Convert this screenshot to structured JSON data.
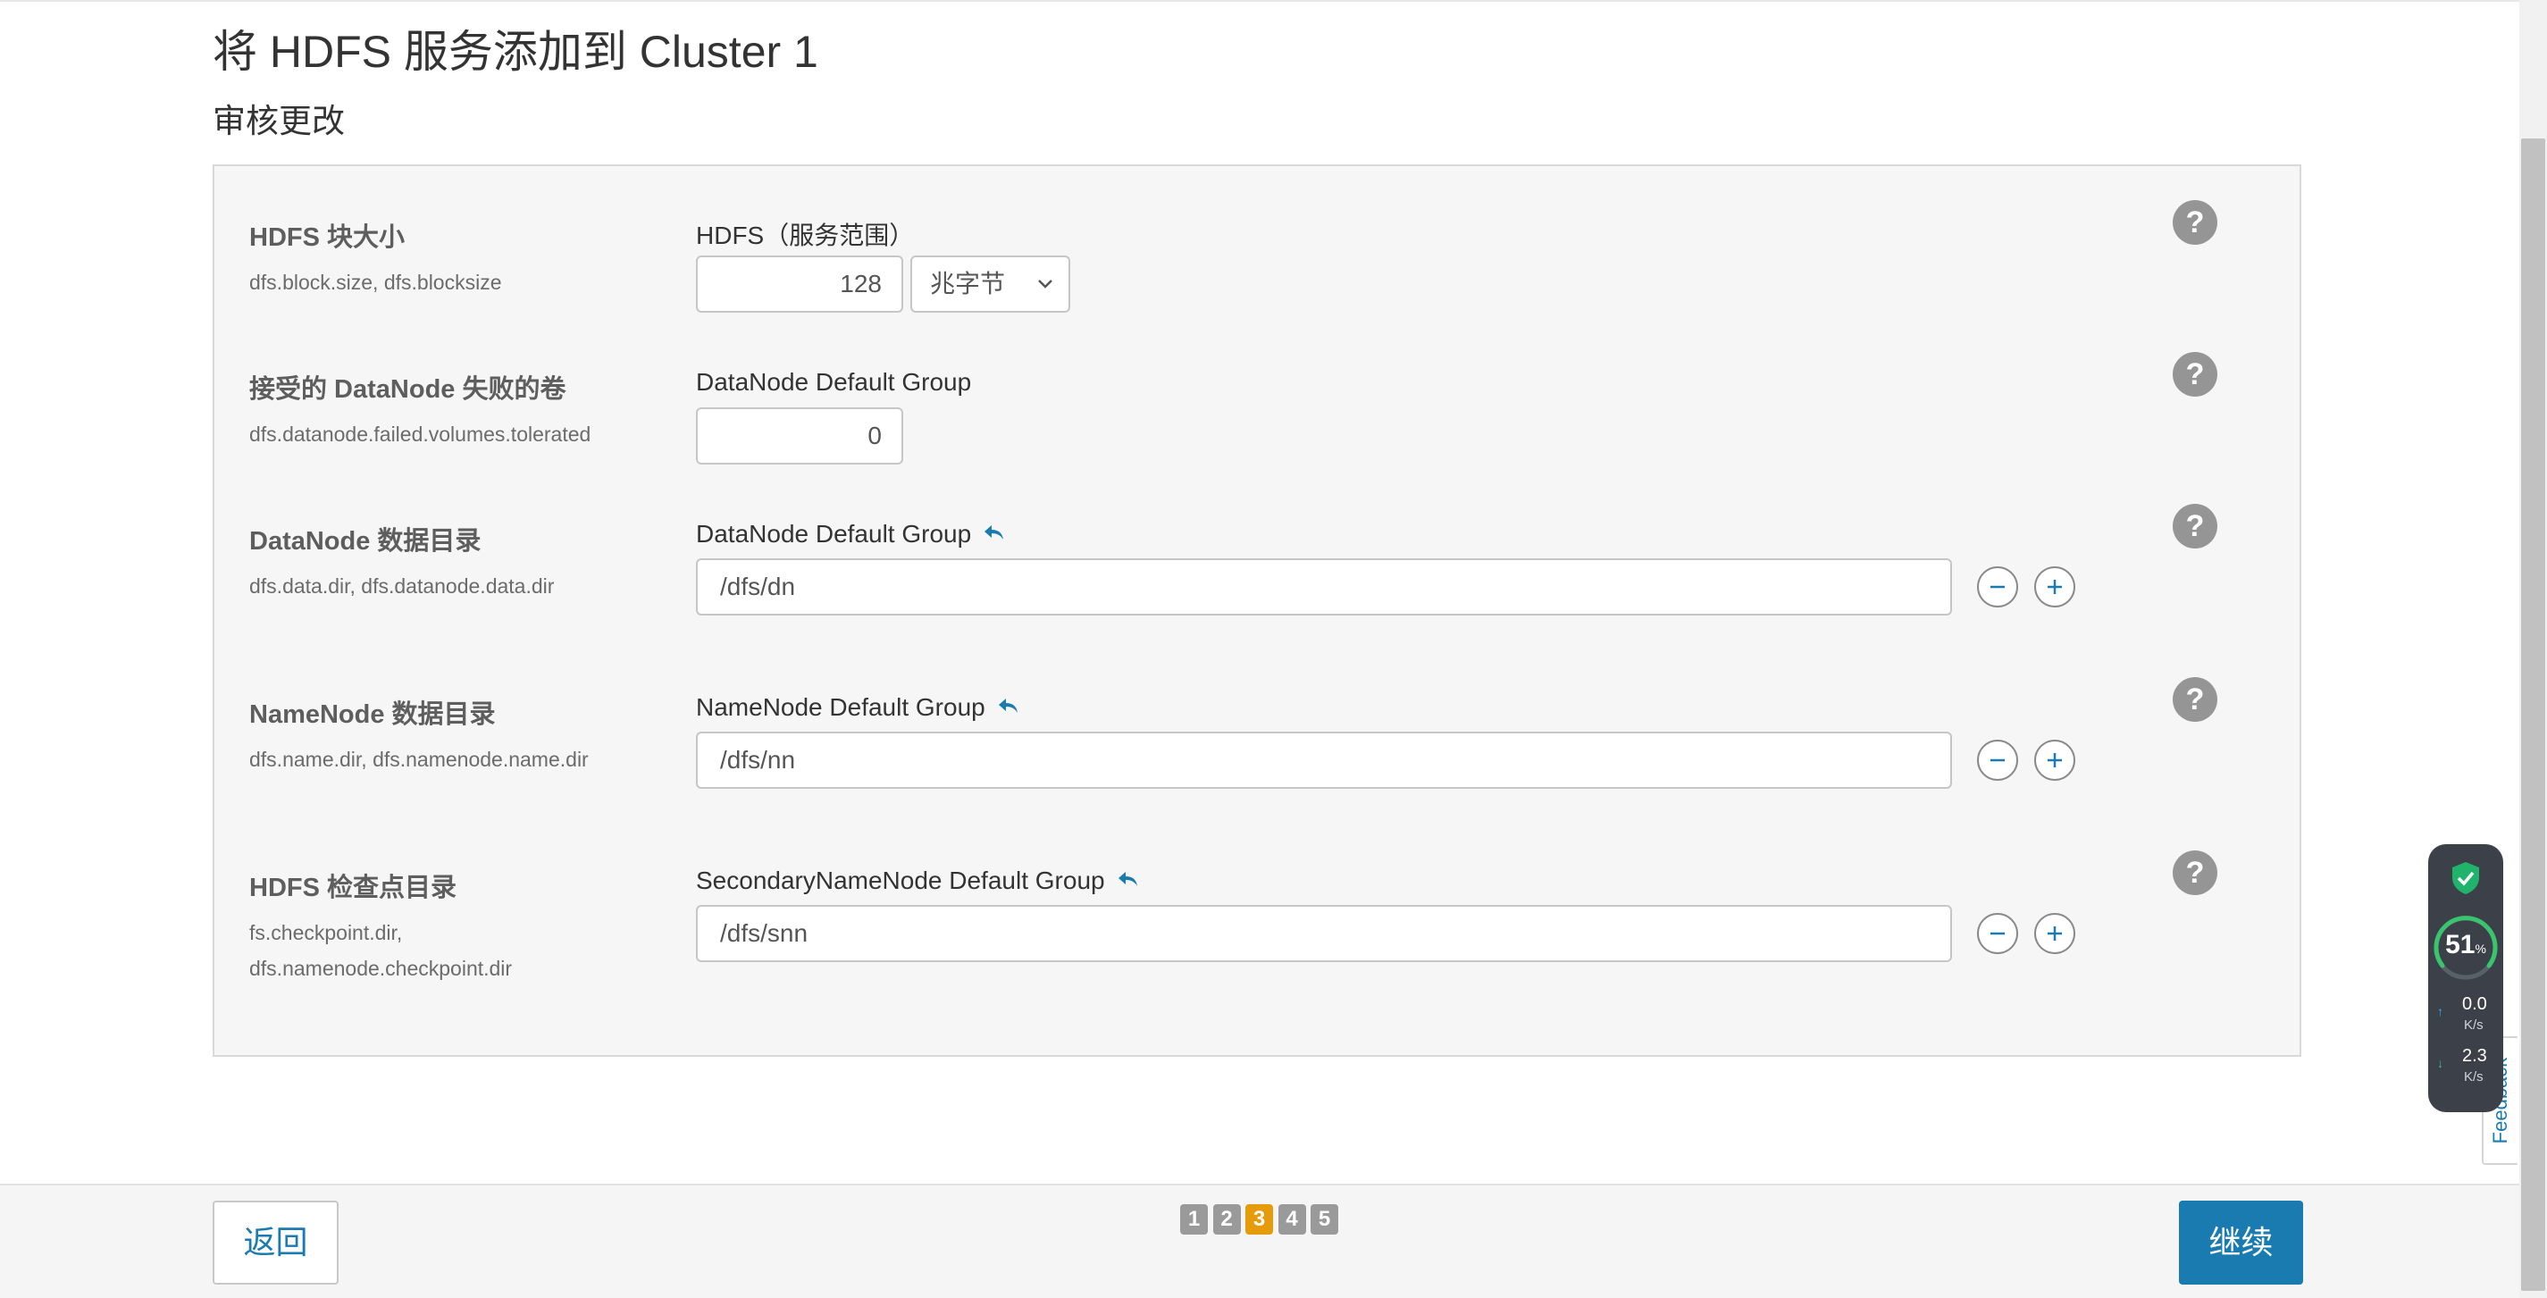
{
  "page": {
    "title": "将 HDFS 服务添加到 Cluster 1",
    "subtitle": "审核更改"
  },
  "properties": [
    {
      "name": "HDFS 块大小",
      "keys": [
        "dfs.block.size, dfs.blocksize"
      ],
      "group": "HDFS（服务范围）",
      "value": "128",
      "unit": "兆字节"
    },
    {
      "name": "接受的 DataNode 失败的卷",
      "keys": [
        "dfs.datanode.failed.volumes.tolerated"
      ],
      "group": "DataNode Default Group",
      "value": "0"
    },
    {
      "name": "DataNode 数据目录",
      "keys": [
        "dfs.data.dir, dfs.datanode.data.dir"
      ],
      "group": "DataNode Default Group",
      "value": "/dfs/dn"
    },
    {
      "name": "NameNode 数据目录",
      "keys": [
        "dfs.name.dir, dfs.namenode.name.dir"
      ],
      "group": "NameNode Default Group",
      "value": "/dfs/nn"
    },
    {
      "name": "HDFS 检查点目录",
      "keys": [
        "fs.checkpoint.dir,",
        "dfs.namenode.checkpoint.dir"
      ],
      "group": "SecondaryNameNode Default Group",
      "value": "/dfs/snn"
    }
  ],
  "help_label": "?",
  "footer": {
    "back_label": "返回",
    "next_label": "继续",
    "steps": [
      "1",
      "2",
      "3",
      "4",
      "5"
    ],
    "active_step": "3"
  },
  "feedback_label": "Feedback",
  "monitor": {
    "percent": "51",
    "percent_unit": "%",
    "upload": "0.0",
    "download": "2.3",
    "rate_unit": "K/s"
  },
  "icons": {
    "undo": "undo-arrow-icon",
    "remove": "minus-circle-icon",
    "add": "plus-circle-icon",
    "help": "question-circle-icon",
    "select": "chevron-down-icon",
    "monitor": "shield-check-icon"
  },
  "colors": {
    "accent": "#1a7bb0",
    "active_step": "#e69b0a",
    "step": "#9a9a9a",
    "help": "#959595",
    "shield": "#1fb36b"
  }
}
